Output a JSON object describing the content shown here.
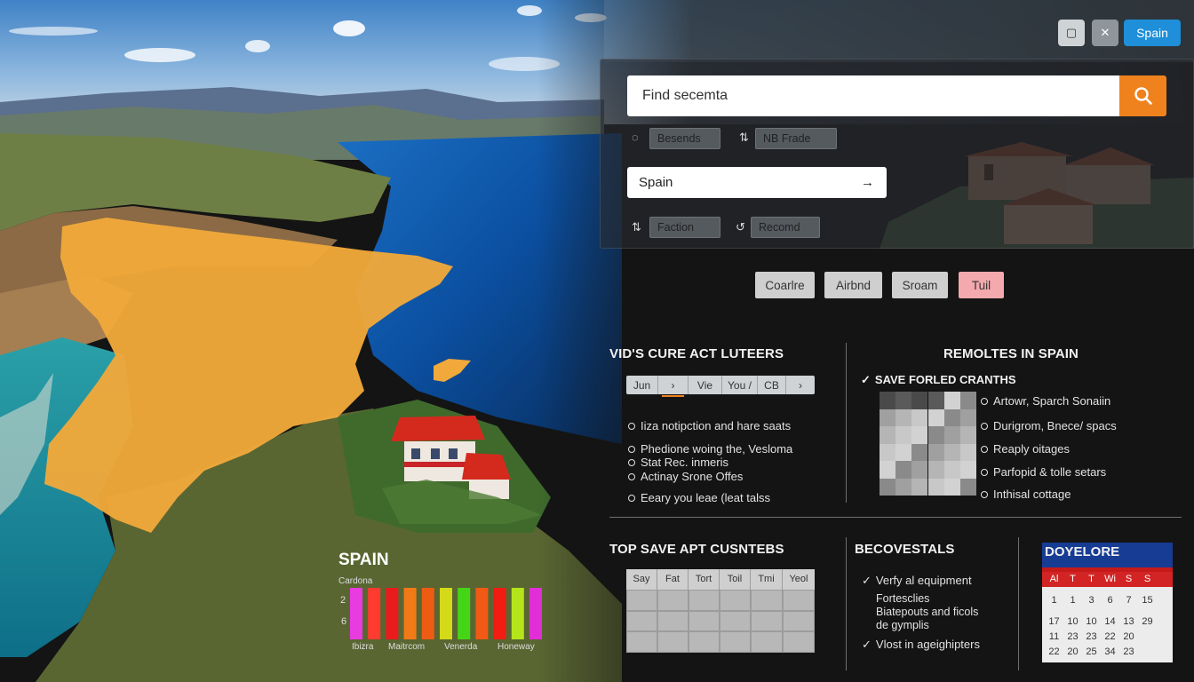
{
  "window": {
    "sq_icon": "▢",
    "close_icon": "✕",
    "region_button": "Spain"
  },
  "search": {
    "placeholder": "Find secemta",
    "chips_row1": [
      {
        "icon": "◌",
        "label": "Besends"
      },
      {
        "icon": "⇅",
        "label": "NB Frade"
      }
    ],
    "location_value": "Spain",
    "location_arrow": "→",
    "chips_row2": [
      {
        "icon": "⇅",
        "label": "Faction"
      },
      {
        "icon": "↺",
        "label": "Recomd"
      }
    ]
  },
  "tags": [
    "Coarlre",
    "Airbnd",
    "Sroam",
    "Tuil"
  ],
  "left_section": {
    "title": "VID'S CURE ACT LUTEERS",
    "tabs": [
      "Jun",
      "›",
      "Vie",
      "You /",
      "CB",
      "›"
    ],
    "items": [
      "Iiza notipction and hare saats",
      "Phedione woing the, Vesloma",
      "Stat Rec. inmeris",
      "Actinay Srone Offes",
      "Eeary you leae (leat talss"
    ]
  },
  "right_section": {
    "title": "REMOLTES IN SPAIN",
    "save_label": "SAVE FORLED CRANTHS",
    "items": [
      "Artowr, Sparch Sonaiin",
      "Durigrom, Bnece/ spacs",
      "Reaply oitages",
      "Parfopid & tolle setars",
      "Inthisal cottage"
    ]
  },
  "bottom_left": {
    "title": "TOP SAVE APT CUSNTEBS",
    "columns": [
      "Say",
      "Fat",
      "Tort",
      "Toil",
      "Tmi",
      "Yeol"
    ]
  },
  "bottom_mid": {
    "title": "BECOVESTALS",
    "items": [
      "Verfy al equipment",
      "Fortesclies",
      "Biatepouts and ficols",
      "de gymplis",
      "Vlost in ageighipters"
    ]
  },
  "calendar": {
    "title": "DOYELORE",
    "days": [
      "Al",
      "T",
      "T",
      "Wi",
      "S",
      "S"
    ],
    "rows": [
      [
        "1",
        "1",
        "3",
        "6",
        "7",
        "15"
      ],
      [
        "17",
        "10",
        "10",
        "14",
        "13",
        "29"
      ],
      [
        "11",
        "23",
        "23",
        "22",
        "20",
        ""
      ],
      [
        "22",
        "20",
        "25",
        "34",
        "23",
        ""
      ]
    ]
  },
  "chart": {
    "title": "SPAIN",
    "subtitle": "Cardona",
    "ytick1": "2",
    "ytick2": "6",
    "xlabels": [
      "Ibizra",
      "Maitrcom",
      "Venerda",
      "Honeway"
    ]
  },
  "chart_data": {
    "type": "bar",
    "title": "SPAIN",
    "subtitle": "Cardona",
    "yticks": [
      "2",
      "6"
    ],
    "xlabels": [
      "Ibizra",
      "Maitrcom",
      "Venerda",
      "Honeway"
    ],
    "values": [
      1,
      1,
      1,
      1,
      1,
      1,
      1,
      1,
      1,
      1,
      1
    ],
    "colors": [
      "#e83be0",
      "#ff3b2f",
      "#ea1b1b",
      "#f27a16",
      "#ee5b12",
      "#d4d918",
      "#44d616",
      "#f05a14",
      "#f11c12",
      "#b4e41a",
      "#e22ed6"
    ]
  },
  "colors": {
    "accent_blue": "#1e8fd8",
    "search_orange": "#f0821e",
    "calendar_blue": "#173c94",
    "calendar_red": "#d22424",
    "spain_orange": "#f0a93a"
  }
}
